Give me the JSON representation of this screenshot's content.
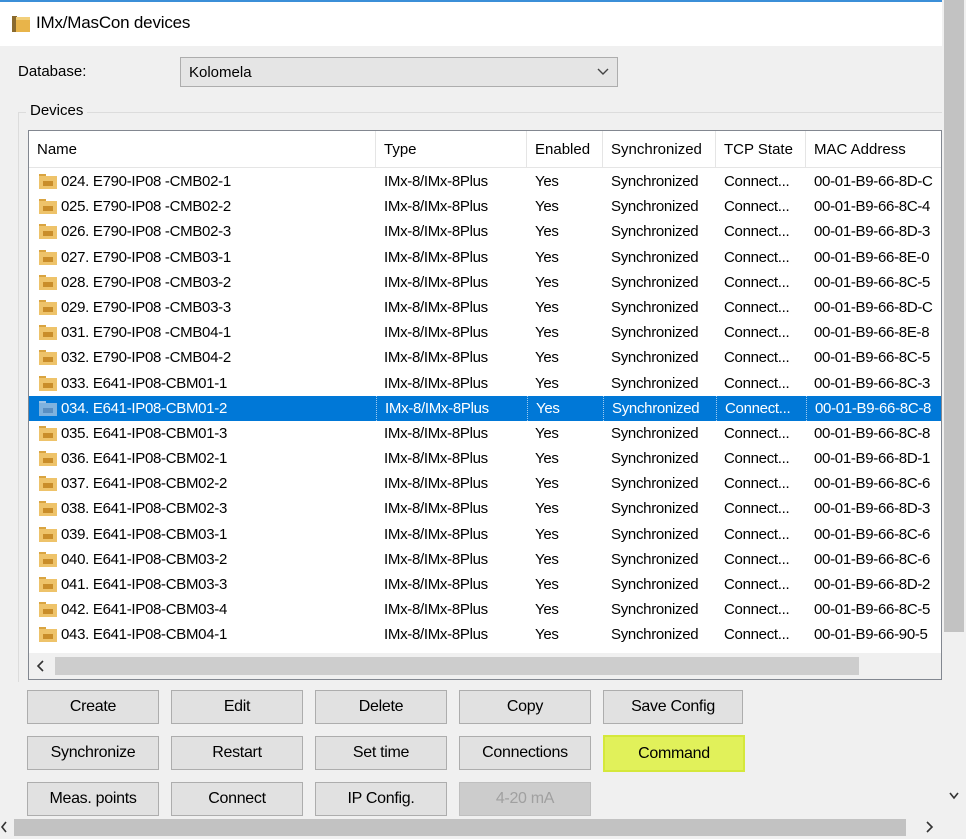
{
  "window": {
    "title": "IMx/MasCon devices"
  },
  "database": {
    "label": "Database:",
    "selected": "Kolomela"
  },
  "devices_group": {
    "label": "Devices"
  },
  "columns": [
    "Name",
    "Type",
    "Enabled",
    "Synchronized",
    "TCP State",
    "MAC Address"
  ],
  "rows": [
    {
      "name": "024. E790-IP08 -CMB02-1",
      "type": "IMx-8/IMx-8Plus",
      "enabled": "Yes",
      "sync": "Synchronized",
      "tcp": "Connect...",
      "mac": "00-01-B9-66-8D-C"
    },
    {
      "name": "025. E790-IP08 -CMB02-2",
      "type": "IMx-8/IMx-8Plus",
      "enabled": "Yes",
      "sync": "Synchronized",
      "tcp": "Connect...",
      "mac": "00-01-B9-66-8C-4"
    },
    {
      "name": "026. E790-IP08 -CMB02-3",
      "type": "IMx-8/IMx-8Plus",
      "enabled": "Yes",
      "sync": "Synchronized",
      "tcp": "Connect...",
      "mac": "00-01-B9-66-8D-3"
    },
    {
      "name": "027. E790-IP08 -CMB03-1",
      "type": "IMx-8/IMx-8Plus",
      "enabled": "Yes",
      "sync": "Synchronized",
      "tcp": "Connect...",
      "mac": "00-01-B9-66-8E-0"
    },
    {
      "name": "028. E790-IP08 -CMB03-2",
      "type": "IMx-8/IMx-8Plus",
      "enabled": "Yes",
      "sync": "Synchronized",
      "tcp": "Connect...",
      "mac": "00-01-B9-66-8C-5"
    },
    {
      "name": "029. E790-IP08 -CMB03-3",
      "type": "IMx-8/IMx-8Plus",
      "enabled": "Yes",
      "sync": "Synchronized",
      "tcp": "Connect...",
      "mac": "00-01-B9-66-8D-C"
    },
    {
      "name": "031. E790-IP08 -CMB04-1",
      "type": "IMx-8/IMx-8Plus",
      "enabled": "Yes",
      "sync": "Synchronized",
      "tcp": "Connect...",
      "mac": "00-01-B9-66-8E-8"
    },
    {
      "name": "032. E790-IP08 -CMB04-2",
      "type": "IMx-8/IMx-8Plus",
      "enabled": "Yes",
      "sync": "Synchronized",
      "tcp": "Connect...",
      "mac": "00-01-B9-66-8C-5"
    },
    {
      "name": "033. E641-IP08-CBM01-1",
      "type": "IMx-8/IMx-8Plus",
      "enabled": "Yes",
      "sync": "Synchronized",
      "tcp": "Connect...",
      "mac": "00-01-B9-66-8C-3"
    },
    {
      "name": "034. E641-IP08-CBM01-2",
      "type": "IMx-8/IMx-8Plus",
      "enabled": "Yes",
      "sync": "Synchronized",
      "tcp": "Connect...",
      "mac": "00-01-B9-66-8C-8",
      "selected": true
    },
    {
      "name": "035. E641-IP08-CBM01-3",
      "type": "IMx-8/IMx-8Plus",
      "enabled": "Yes",
      "sync": "Synchronized",
      "tcp": "Connect...",
      "mac": "00-01-B9-66-8C-8"
    },
    {
      "name": "036. E641-IP08-CBM02-1",
      "type": "IMx-8/IMx-8Plus",
      "enabled": "Yes",
      "sync": "Synchronized",
      "tcp": "Connect...",
      "mac": "00-01-B9-66-8D-1"
    },
    {
      "name": "037. E641-IP08-CBM02-2",
      "type": "IMx-8/IMx-8Plus",
      "enabled": "Yes",
      "sync": "Synchronized",
      "tcp": "Connect...",
      "mac": "00-01-B9-66-8C-6"
    },
    {
      "name": "038. E641-IP08-CBM02-3",
      "type": "IMx-8/IMx-8Plus",
      "enabled": "Yes",
      "sync": "Synchronized",
      "tcp": "Connect...",
      "mac": "00-01-B9-66-8D-3"
    },
    {
      "name": "039. E641-IP08-CBM03-1",
      "type": "IMx-8/IMx-8Plus",
      "enabled": "Yes",
      "sync": "Synchronized",
      "tcp": "Connect...",
      "mac": "00-01-B9-66-8C-6"
    },
    {
      "name": "040. E641-IP08-CBM03-2",
      "type": "IMx-8/IMx-8Plus",
      "enabled": "Yes",
      "sync": "Synchronized",
      "tcp": "Connect...",
      "mac": "00-01-B9-66-8C-6"
    },
    {
      "name": "041. E641-IP08-CBM03-3",
      "type": "IMx-8/IMx-8Plus",
      "enabled": "Yes",
      "sync": "Synchronized",
      "tcp": "Connect...",
      "mac": "00-01-B9-66-8D-2"
    },
    {
      "name": "042. E641-IP08-CBM03-4",
      "type": "IMx-8/IMx-8Plus",
      "enabled": "Yes",
      "sync": "Synchronized",
      "tcp": "Connect...",
      "mac": "00-01-B9-66-8C-5"
    },
    {
      "name": "043. E641-IP08-CBM04-1",
      "type": "IMx-8/IMx-8Plus",
      "enabled": "Yes",
      "sync": "Synchronized",
      "tcp": "Connect...",
      "mac": "00-01-B9-66-90-5"
    }
  ],
  "buttons": {
    "create": "Create",
    "edit": "Edit",
    "delete": "Delete",
    "copy": "Copy",
    "save_config": "Save Config",
    "synchronize": "Synchronize",
    "restart": "Restart",
    "set_time": "Set time",
    "connections": "Connections",
    "command": "Command",
    "meas_points": "Meas. points",
    "connect": "Connect",
    "ip_config": "IP Config.",
    "ma_4_20": "4-20 mA"
  },
  "colors": {
    "selection": "#0078d7",
    "highlight": "#e1f15a",
    "folder": "#e8b44a"
  },
  "icons": {
    "window": "folder-icon",
    "row": "device-folder-icon",
    "dropdown": "chevron-down-icon"
  }
}
